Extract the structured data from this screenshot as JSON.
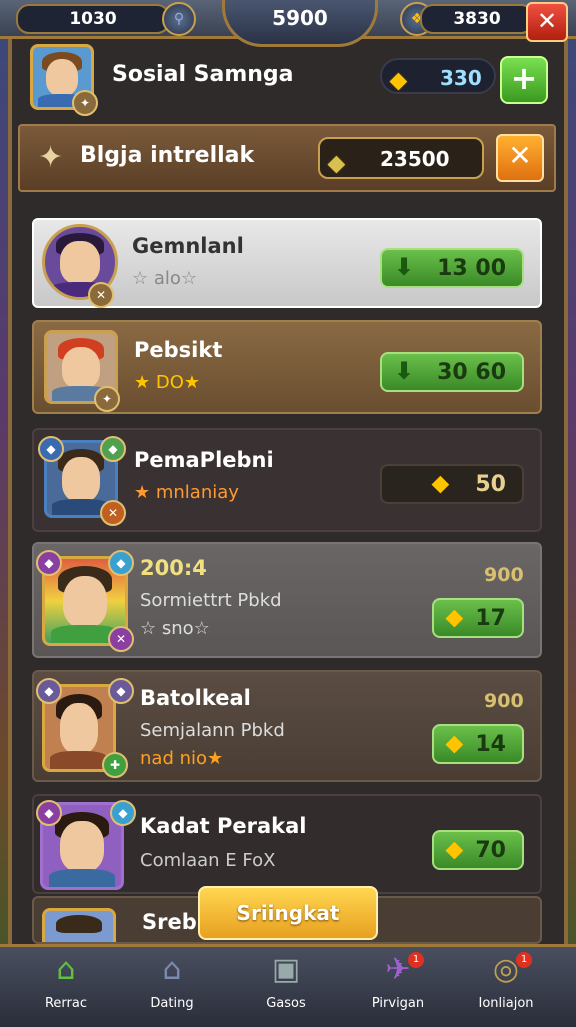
{
  "top_bar": {
    "left_value": "1030",
    "center_value": "5900",
    "right_value": "3830",
    "close_symbol": "✕"
  },
  "profile": {
    "name": "Sosial Samnga",
    "coins": "330",
    "add_symbol": "+"
  },
  "header": {
    "title": "Blgja intrellak",
    "value": "23500",
    "close_symbol": "✕"
  },
  "list": [
    {
      "name": "Gemnlanl",
      "stars": "☆ alo☆",
      "price": "13 00",
      "price_style": "green"
    },
    {
      "name": "Pebsikt",
      "stars": "★ DO★",
      "price": "30 60",
      "price_style": "green"
    },
    {
      "name": "PemaPlebni",
      "stars": "★ mnlaniay",
      "price": "50",
      "price_style": "dark"
    },
    {
      "name": "200:4",
      "sub": "Sormiettrt Pbkd",
      "stars": "☆ sno☆",
      "top_value": "900",
      "price": "17",
      "price_style": "green"
    },
    {
      "name": "Batolkeal",
      "sub": "Semjalann Pbkd",
      "stars": "nad nio★",
      "top_value": "900",
      "price": "14",
      "price_style": "green"
    },
    {
      "name": "Kadat Perakal",
      "sub": "Comlaan E FoX",
      "price": "70",
      "price_style": "green"
    },
    {
      "name": "Srebl"
    }
  ],
  "floating_button": "Sriingkat",
  "nav": [
    {
      "label": "Rerrac",
      "icon": "home-icon"
    },
    {
      "label": "Dating",
      "icon": "house-icon"
    },
    {
      "label": "Gasos",
      "icon": "console-icon"
    },
    {
      "label": "Pirvigan",
      "icon": "plane-icon",
      "badge": "1"
    },
    {
      "label": "Ionliajon",
      "icon": "compass-icon",
      "badge": "1"
    }
  ]
}
